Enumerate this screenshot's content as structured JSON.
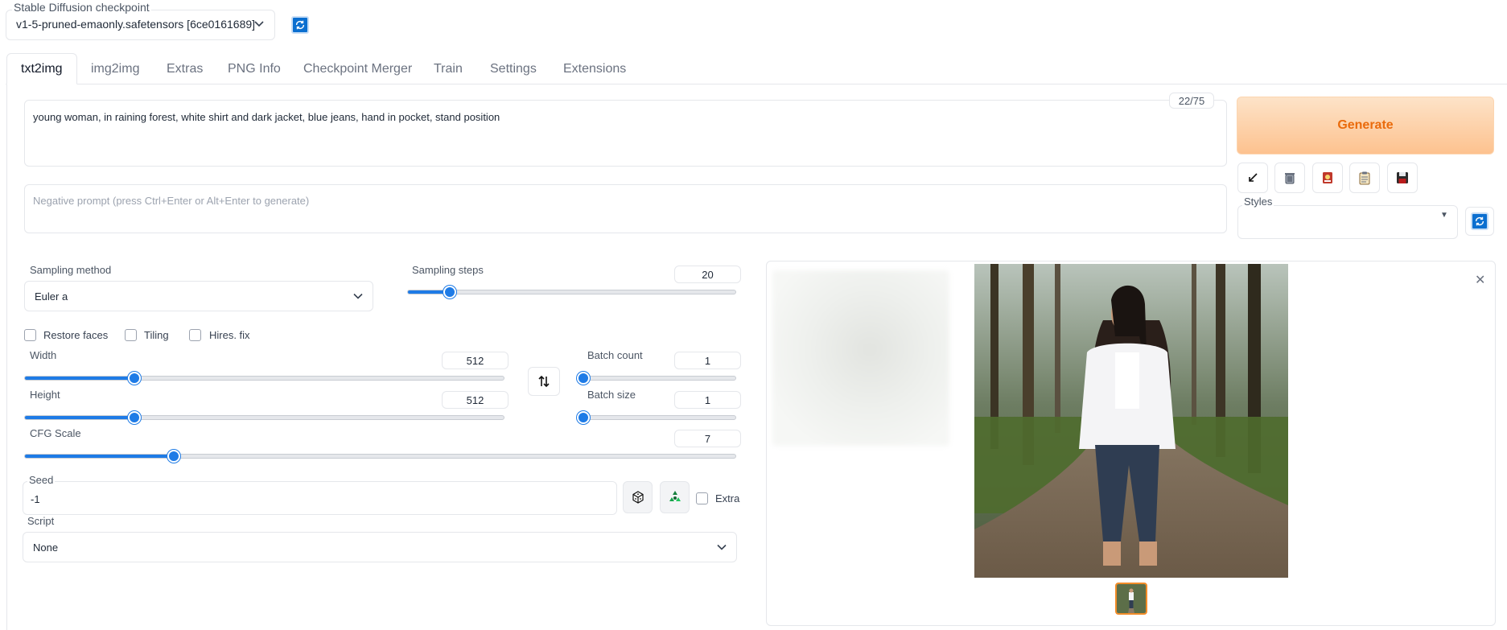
{
  "checkpoint": {
    "label": "Stable Diffusion checkpoint",
    "value": "v1-5-pruned-emaonly.safetensors [6ce0161689]"
  },
  "tabs": [
    {
      "label": "txt2img",
      "active": true
    },
    {
      "label": "img2img"
    },
    {
      "label": "Extras"
    },
    {
      "label": "PNG Info"
    },
    {
      "label": "Checkpoint Merger"
    },
    {
      "label": "Train"
    },
    {
      "label": "Settings"
    },
    {
      "label": "Extensions"
    }
  ],
  "prompt": {
    "value": "young woman, in raining forest, white shirt and dark jacket, blue jeans, hand in pocket, stand position",
    "token_count": "22/75",
    "negative_placeholder": "Negative prompt (press Ctrl+Enter or Alt+Enter to generate)"
  },
  "actions": {
    "generate_label": "Generate",
    "tools": [
      "arrow-icon",
      "trash-icon",
      "card-icon",
      "clipboard-icon",
      "save-icon"
    ]
  },
  "styles": {
    "label": "Styles",
    "value": ""
  },
  "sampling": {
    "method_label": "Sampling method",
    "method_value": "Euler a",
    "steps_label": "Sampling steps",
    "steps_value": "20",
    "steps_fraction": 0.13
  },
  "checkboxes": {
    "restore_faces": "Restore faces",
    "tiling": "Tiling",
    "hires_fix": "Hires. fix"
  },
  "dimensions": {
    "width_label": "Width",
    "width_value": "512",
    "width_fraction": 0.23,
    "height_label": "Height",
    "height_value": "512",
    "height_fraction": 0.23
  },
  "batch": {
    "count_label": "Batch count",
    "count_value": "1",
    "count_fraction": 0.0,
    "size_label": "Batch size",
    "size_value": "1",
    "size_fraction": 0.0
  },
  "cfg": {
    "label": "CFG Scale",
    "value": "7",
    "fraction": 0.21
  },
  "seed": {
    "label": "Seed",
    "value": "-1",
    "extra_label": "Extra"
  },
  "script": {
    "label": "Script",
    "value": "None"
  },
  "colors": {
    "accent": "#1e7be6",
    "generate": "#ea6b0c"
  }
}
